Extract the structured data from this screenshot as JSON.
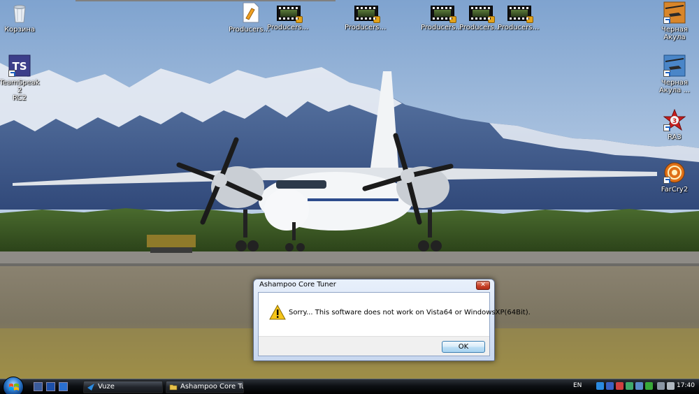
{
  "desktop": {
    "left_icons": [
      {
        "label": "Корзина",
        "icon": "recycle-bin-icon"
      },
      {
        "label": "TeamSpeak 2\nRC2",
        "icon": "teamspeak-icon"
      }
    ],
    "top_icons": [
      {
        "label": "Producers ...",
        "icon": "document-icon"
      },
      {
        "label": "Producers ...",
        "icon": "video-file-icon"
      },
      {
        "label": "Producers ...",
        "icon": "video-file-icon"
      },
      {
        "label": "Producers ...",
        "icon": "video-file-icon"
      },
      {
        "label": "Producers ...",
        "icon": "video-file-icon"
      },
      {
        "label": "Producers ...",
        "icon": "video-file-icon"
      }
    ],
    "right_icons": [
      {
        "label": "Черная\nАкула",
        "icon": "black-shark-helicopter-icon"
      },
      {
        "label": "Черная\nАкула ...",
        "icon": "black-shark-helicopter-icon"
      },
      {
        "label": "RA3",
        "icon": "red-alert-3-icon"
      },
      {
        "label": "FarCry2",
        "icon": "farcry2-icon"
      }
    ]
  },
  "dialog": {
    "title": "Ashampoo Core Tuner",
    "message": "Sorry... This software does not work on Vista64 or WindowsXP(64Bit).",
    "ok_label": "OK",
    "close_label": "✕"
  },
  "taskbar": {
    "buttons": [
      {
        "label": "Vuze",
        "icon": "vuze-icon"
      },
      {
        "label": "Ashampoo Core Tu...",
        "icon": "folder-icon"
      }
    ],
    "language": "EN",
    "clock": "17:40"
  },
  "colors": {
    "sky": "#b8cde6",
    "mountain_snow": "#eef3fa",
    "taskbar": "#0d1014",
    "warning_yellow": "#f6c519"
  }
}
